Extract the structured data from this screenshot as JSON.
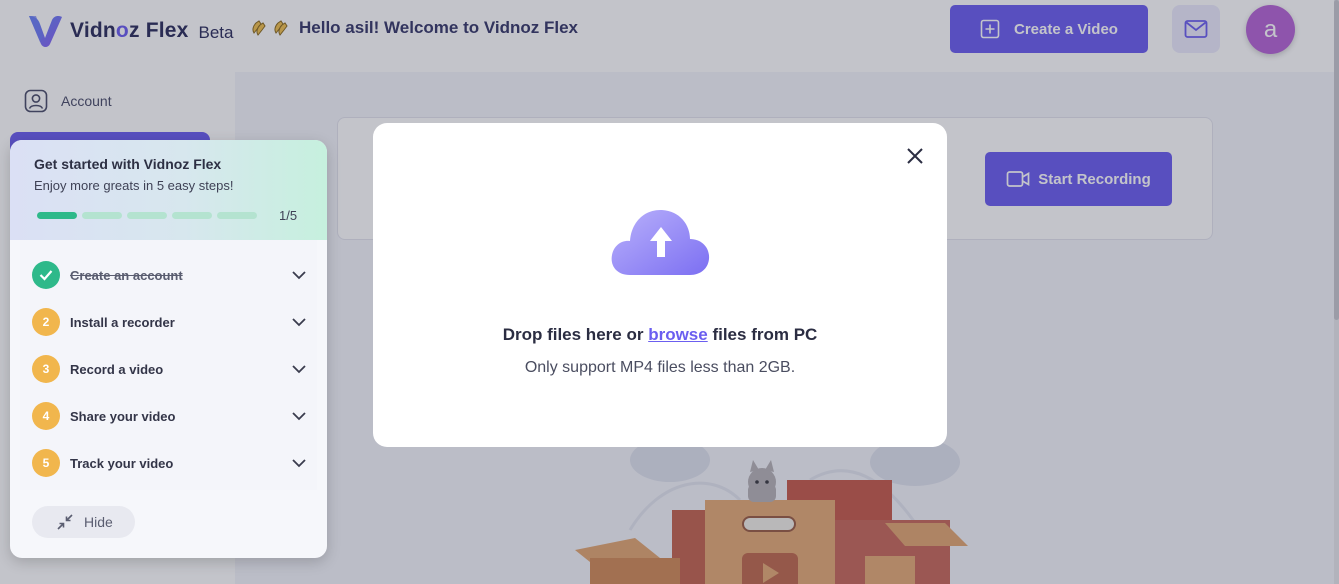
{
  "header": {
    "logo_brand_a": "Vidn",
    "logo_brand_b": "o",
    "logo_brand_c": "z Flex",
    "beta": "Beta",
    "welcome": "Hello asil! Welcome to Vidnoz Flex",
    "create_video_label": "Create a Video",
    "avatar_initial": "a"
  },
  "sidebar": {
    "items": [
      {
        "label": "Account",
        "icon": "account-icon"
      }
    ]
  },
  "main": {
    "start_recording_label": "Start Recording"
  },
  "get_started": {
    "title": "Get started with Vidnoz Flex",
    "subtitle": "Enjoy more greats in 5 easy steps!",
    "progress": {
      "done": 1,
      "total": 5
    },
    "count": "1/5",
    "steps": [
      {
        "num": "1",
        "label": "Create an account",
        "completed": true
      },
      {
        "num": "2",
        "label": "Install a recorder",
        "completed": false
      },
      {
        "num": "3",
        "label": "Record a video",
        "completed": false
      },
      {
        "num": "4",
        "label": "Share your video",
        "completed": false
      },
      {
        "num": "5",
        "label": "Track your video",
        "completed": false
      }
    ],
    "hide_label": "Hide"
  },
  "modal": {
    "drop_prefix": "Drop files here or",
    "browse": "browse",
    "drop_suffix": "files from PC",
    "support": "Only support MP4 files less than 2GB."
  },
  "colors": {
    "accent": "#6b5ef0",
    "success": "#2eb98a",
    "step_pending": "#f1b64d",
    "avatar": "#b665d6"
  }
}
